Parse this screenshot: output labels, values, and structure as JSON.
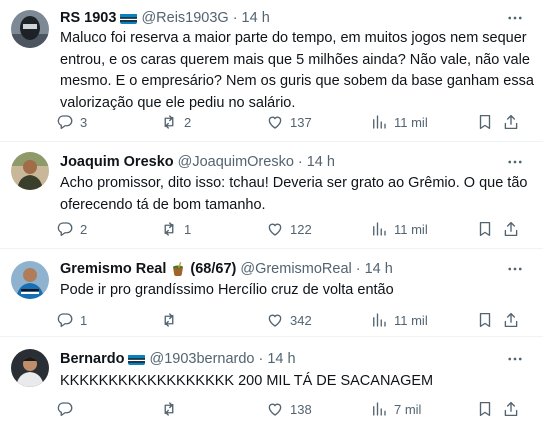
{
  "tweets": [
    {
      "name": "RS 1903",
      "handle": "@Reis1903G",
      "sep": "·",
      "time": "14 h",
      "lines": [
        "Maluco foi reserva a maior parte do tempo, em muitos jogos nem sequer",
        "entrou, e os caras querem mais que 5 milhões ainda? Não vale, não vale",
        "mesmo. E o empresário? Nem os guris que sobem da base ganham essa",
        "valorização que ele pediu no salário."
      ],
      "replies": "3",
      "retweets": "2",
      "likes": "137",
      "views": "11 mil"
    },
    {
      "name": "Joaquim Oresko",
      "handle": "@JoaquimOresko",
      "sep": "·",
      "time": "14 h",
      "lines": [
        "Acho promissor, dito isso: tchau! Deveria ser grato ao Grêmio. O que tão",
        "oferecendo tá de bom tamanho."
      ],
      "replies": "2",
      "retweets": "1",
      "likes": "122",
      "views": "11 mil"
    },
    {
      "name": "Gremismo Real",
      "name_suffix": "(68/67)",
      "handle": "@GremismoReal",
      "sep": "·",
      "time": "14 h",
      "lines": [
        "Pode ir pro grandíssimo Hercílio cruz de volta então"
      ],
      "replies": "1",
      "retweets": "",
      "likes": "342",
      "views": "11 mil"
    },
    {
      "name": "Bernardo",
      "handle": "@1903bernardo",
      "sep": "·",
      "time": "14 h",
      "lines": [
        "KKKKKKKKKKKKKKKKKK 200 MIL TÁ DE SACANAGEM"
      ],
      "replies": "",
      "retweets": "",
      "likes": "138",
      "views": "7 mil"
    }
  ],
  "icons": {
    "more": "more-icon",
    "reply": "reply-icon",
    "retweet": "retweet-icon",
    "like": "heart-icon",
    "views": "views-icon",
    "bookmark": "bookmark-icon",
    "share": "share-icon",
    "flag": "gremio-flag-icon",
    "mate": "mate-cup-icon"
  },
  "colors": {
    "text": "#0f1419",
    "secondary": "#536471",
    "divider": "#eff3f4",
    "flag_blue": "#0d80bf"
  }
}
